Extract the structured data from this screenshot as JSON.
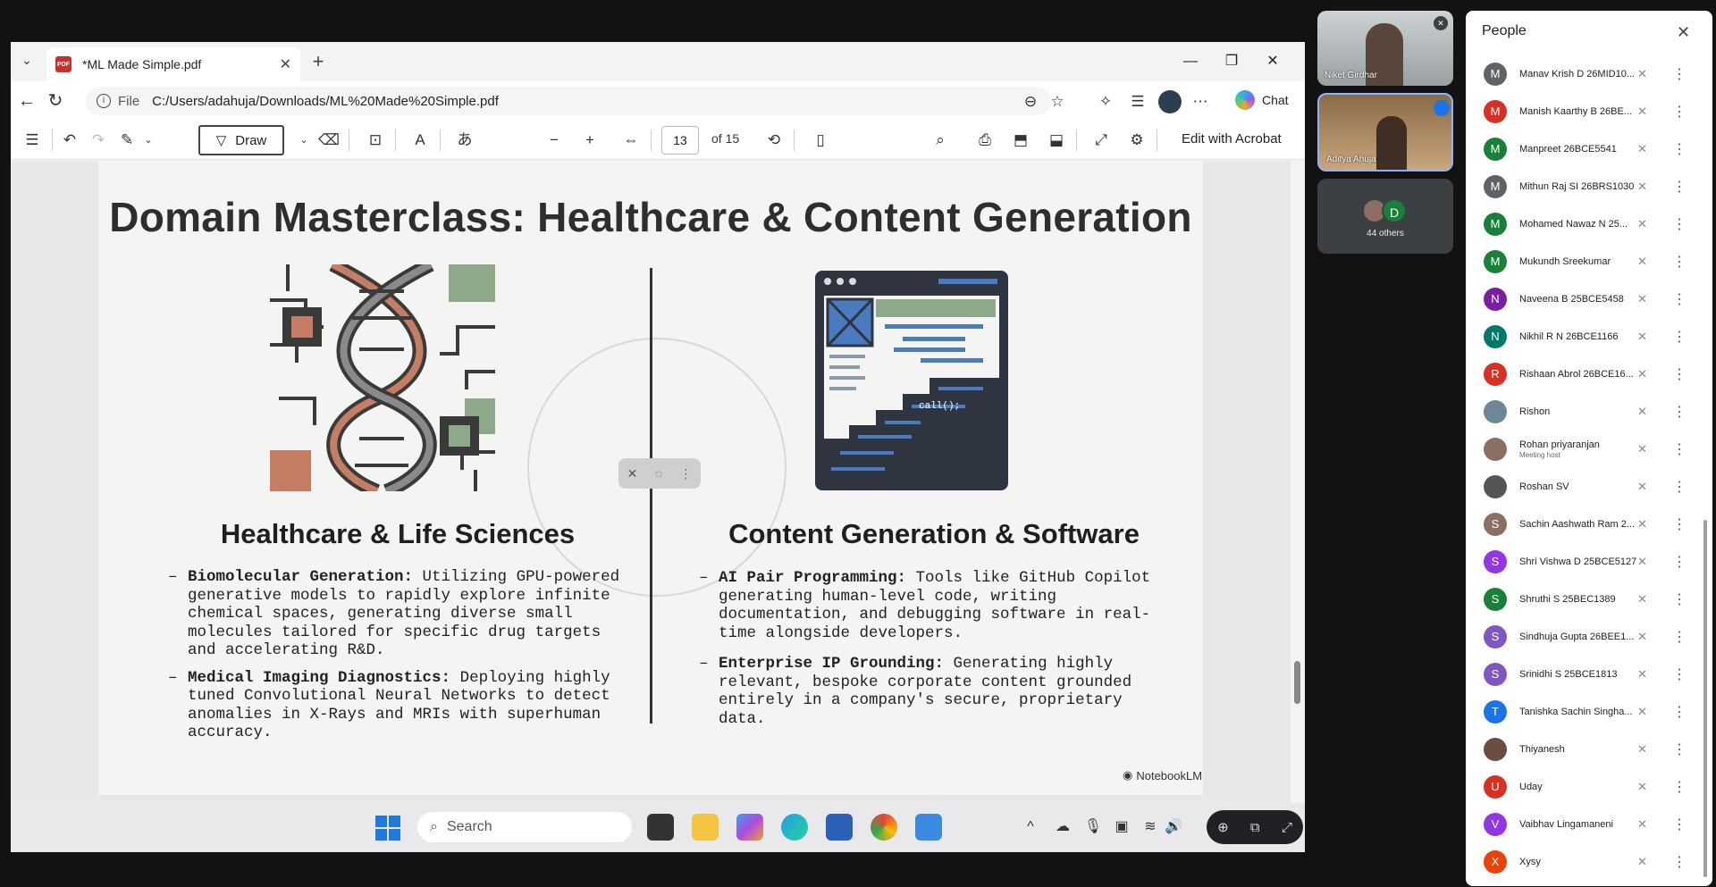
{
  "browser": {
    "tab_title": "*ML Made Simple.pdf",
    "pdf_badge": "PDF",
    "file_label": "File",
    "url": "C:/Users/adahuja/Downloads/ML%20Made%20Simple.pdf",
    "chat_label": "Chat"
  },
  "toolbar": {
    "draw_label": "Draw",
    "page_number": "13",
    "page_total": "of 15",
    "edit_acrobat": "Edit with Acrobat"
  },
  "slide": {
    "title": "Domain Masterclass: Healthcare & Content Generation",
    "left": {
      "heading": "Healthcare & Life Sciences",
      "bullets": [
        {
          "bold": "Biomolecular Generation:",
          "text": " Utilizing GPU-powered generative models to rapidly explore infinite chemical spaces, generating diverse small molecules tailored for specific drug targets and accelerating R&D."
        },
        {
          "bold": "Medical Imaging Diagnostics:",
          "text": " Deploying highly tuned Convolutional Neural Networks to detect anomalies in X-Rays and MRIs with superhuman accuracy."
        }
      ]
    },
    "right": {
      "heading": "Content Generation & Software",
      "bullets": [
        {
          "bold": "AI Pair Programming:",
          "text": " Tools like GitHub Copilot generating human-level code, writing documentation, and debugging software in real-time alongside developers."
        },
        {
          "bold": "Enterprise IP Grounding:",
          "text": " Generating highly relevant, bespoke corporate content grounded entirely in a company's secure, proprietary data."
        }
      ]
    },
    "code_call": "call();",
    "brand": "NotebookLM"
  },
  "taskbar": {
    "search_label": "Search"
  },
  "video": {
    "tile1_name": "Niket Girdhar",
    "tile2_name": "Aditya Ahuja",
    "others_label": "44 others",
    "others_initial": "D"
  },
  "people": {
    "title": "People",
    "list": [
      {
        "initial": "M",
        "color": "#5f6368",
        "name": "Manav Krish D 26MID10...",
        "sub": ""
      },
      {
        "initial": "M",
        "color": "#d93025",
        "name": "Manish Kaarthy B 26BE...",
        "sub": ""
      },
      {
        "initial": "M",
        "color": "#188038",
        "name": "Manpreet 26BCE5541",
        "sub": ""
      },
      {
        "initial": "M",
        "color": "#5f6368",
        "name": "Mithun Raj SI 26BRS1030",
        "sub": ""
      },
      {
        "initial": "M",
        "color": "#188038",
        "name": "Mohamed Nawaz N 25...",
        "sub": ""
      },
      {
        "initial": "M",
        "color": "#188038",
        "name": "Mukundh Sreekumar",
        "sub": ""
      },
      {
        "initial": "N",
        "color": "#7b1fa2",
        "name": "Naveena B 25BCE5458",
        "sub": ""
      },
      {
        "initial": "N",
        "color": "#00796b",
        "name": "Nikhil R N 26BCE1166",
        "sub": ""
      },
      {
        "initial": "R",
        "color": "#d93025",
        "name": "Rishaan Abrol 26BCE16...",
        "sub": ""
      },
      {
        "initial": "",
        "color": "#6d8799",
        "name": "Rishon",
        "sub": ""
      },
      {
        "initial": "",
        "color": "#8d6e63",
        "name": "Rohan priyaranjan",
        "sub": "Meeting host"
      },
      {
        "initial": "",
        "color": "#555555",
        "name": "Roshan SV",
        "sub": ""
      },
      {
        "initial": "S",
        "color": "#8d6e63",
        "name": "Sachin Aashwath Ram 2...",
        "sub": ""
      },
      {
        "initial": "S",
        "color": "#9334e6",
        "name": "Shri Vishwa D 25BCE5127",
        "sub": ""
      },
      {
        "initial": "S",
        "color": "#188038",
        "name": "Shruthi S 25BEC1389",
        "sub": ""
      },
      {
        "initial": "S",
        "color": "#7e57c2",
        "name": "Sindhuja Gupta 26BEE1...",
        "sub": ""
      },
      {
        "initial": "S",
        "color": "#7e57c2",
        "name": "Srinidhi S 25BCE1813",
        "sub": ""
      },
      {
        "initial": "T",
        "color": "#1a73e8",
        "name": "Tanishka Sachin Singha...",
        "sub": ""
      },
      {
        "initial": "",
        "color": "#6d4c41",
        "name": "Thiyanesh",
        "sub": ""
      },
      {
        "initial": "U",
        "color": "#d93025",
        "name": "Uday",
        "sub": ""
      },
      {
        "initial": "V",
        "color": "#9334e6",
        "name": "Vaibhav Lingamaneni",
        "sub": ""
      },
      {
        "initial": "X",
        "color": "#e8430a",
        "name": "Xysy",
        "sub": ""
      }
    ]
  }
}
